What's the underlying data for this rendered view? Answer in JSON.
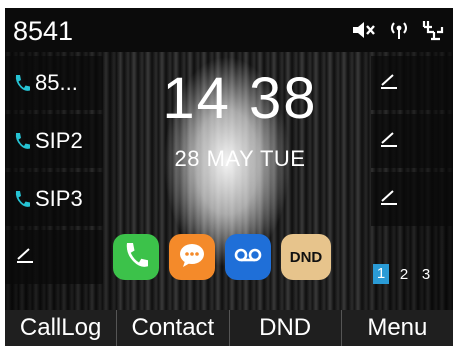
{
  "statusbar": {
    "account": "8541",
    "icons": [
      "mute-icon",
      "wireless-icon",
      "network-icon"
    ]
  },
  "clock": {
    "time": "14 38",
    "date": "28 MAY TUE"
  },
  "left_keys": [
    {
      "label": "85...",
      "icon": "phone-icon"
    },
    {
      "label": "SIP2",
      "icon": "phone-icon"
    },
    {
      "label": "SIP3",
      "icon": "phone-icon"
    },
    {
      "label": "",
      "icon": "edit-icon"
    }
  ],
  "right_keys": [
    {
      "icon": "edit-icon"
    },
    {
      "icon": "edit-icon"
    },
    {
      "icon": "edit-icon"
    }
  ],
  "apps": [
    {
      "name": "call",
      "icon": "phone-icon",
      "color": "#3cc24a"
    },
    {
      "name": "message",
      "icon": "chat-icon",
      "color": "#f48a2a"
    },
    {
      "name": "voicemail",
      "icon": "voicemail-icon",
      "color": "#1f6fd8"
    },
    {
      "name": "dnd",
      "label": "DND",
      "color": "#e7c48c"
    }
  ],
  "pages": [
    "1",
    "2",
    "3"
  ],
  "active_page": "1",
  "softkeys": [
    "CallLog",
    "Contact",
    "DND",
    "Menu"
  ]
}
